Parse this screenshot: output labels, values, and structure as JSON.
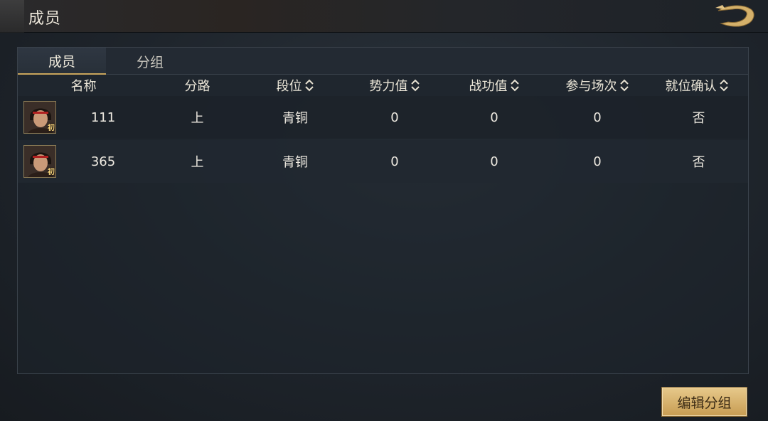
{
  "header": {
    "title": "成员"
  },
  "tabs": [
    {
      "label": "成员",
      "active": true
    },
    {
      "label": "分组",
      "active": false
    }
  ],
  "columns": [
    {
      "label": "名称",
      "sortable": false
    },
    {
      "label": "分路",
      "sortable": false
    },
    {
      "label": "段位",
      "sortable": true
    },
    {
      "label": "势力值",
      "sortable": true
    },
    {
      "label": "战功值",
      "sortable": true
    },
    {
      "label": "参与场次",
      "sortable": true
    },
    {
      "label": "就位确认",
      "sortable": true
    }
  ],
  "rows": [
    {
      "avatar_badge": "初",
      "name": "111",
      "lane": "上",
      "rank": "青铜",
      "power": "0",
      "merit": "0",
      "matches": "0",
      "confirmed": "否"
    },
    {
      "avatar_badge": "初",
      "name": "365",
      "lane": "上",
      "rank": "青铜",
      "power": "0",
      "merit": "0",
      "matches": "0",
      "confirmed": "否"
    }
  ],
  "footer": {
    "edit_group_label": "编辑分组"
  },
  "colors": {
    "accent": "#c9a55c",
    "button_bg": "#d9b46e",
    "panel_bg": "#1e242b"
  },
  "icons": {
    "back": "dragon-back-icon",
    "sort": "sort-updown-icon"
  }
}
